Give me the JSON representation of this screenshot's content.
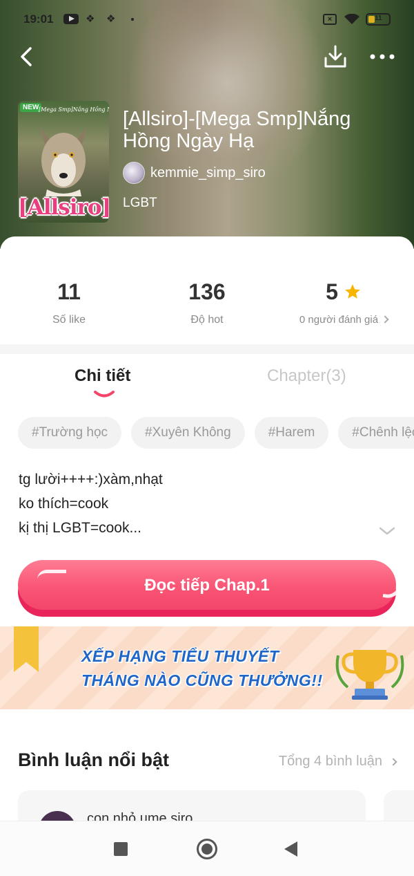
{
  "status_bar": {
    "time": "19:01",
    "battery": "11",
    "icons": [
      "youtube-icon",
      "dropbox-icon",
      "dropbox-icon",
      "dot-icon",
      "sim-off-icon",
      "wifi-icon",
      "battery-icon"
    ]
  },
  "top_nav": {
    "back_icon": "chevron-left-icon",
    "download_icon": "download-icon",
    "more_icon": "more-dots-icon"
  },
  "cover": {
    "badge": "NEW",
    "subtitle": "[Mega Smp]Nắng Hồng Ngày Hạ",
    "title": "[Allsiro]"
  },
  "story": {
    "title": "[Allsiro]-[Mega Smp]Nắng Hồng Ngày Hạ",
    "author": "kemmie_simp_siro",
    "genre": "LGBT"
  },
  "stats": {
    "likes_value": "11",
    "likes_label": "Số like",
    "hot_value": "136",
    "hot_label": "Độ hot",
    "rating_value": "5",
    "rating_label": "0 người đánh giá"
  },
  "tabs": {
    "detail": "Chi tiết",
    "chapter": "Chapter(3)"
  },
  "tags": [
    "#Trường học",
    "#Xuyên Không",
    "#Harem",
    "#Chênh lệch"
  ],
  "description": {
    "line1": "tg lười++++:)xàm,nhạt",
    "line2": "ko thích=cook",
    "line3": "kị thị LGBT=cook..."
  },
  "read_button": "Đọc tiếp Chap.1",
  "banner": {
    "line1": "XẾP HẠNG TIỂU THUYẾT",
    "line2": "THÁNG NÀO CŨNG THƯỞNG!!"
  },
  "comments": {
    "title": "Bình luận nổi bật",
    "total": "Tổng 4 bình luận",
    "first_author": "con nhỏ ume siro"
  },
  "colors": {
    "accent": "#f95575",
    "star": "#f7b500",
    "banner_text": "#2066c8"
  }
}
